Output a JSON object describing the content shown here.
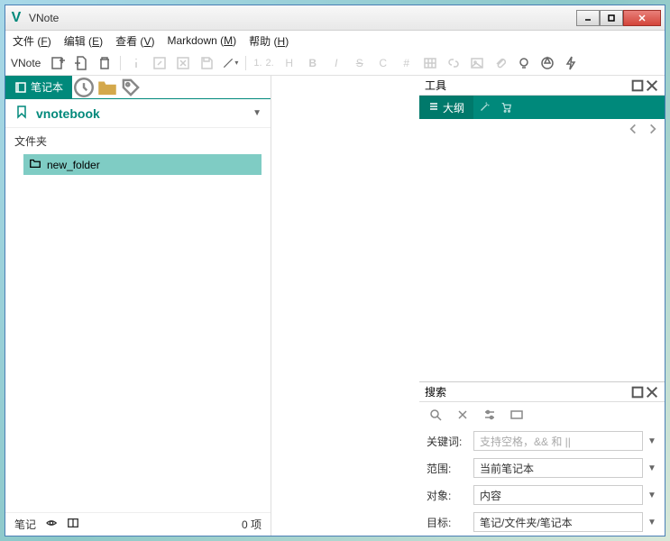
{
  "app": {
    "title": "VNote"
  },
  "menu": {
    "file": "文件",
    "file_k": "F",
    "edit": "编辑",
    "edit_k": "E",
    "view": "查看",
    "view_k": "V",
    "markdown": "Markdown",
    "markdown_k": "M",
    "help": "帮助",
    "help_k": "H"
  },
  "toolbar": {
    "label": "VNote",
    "numbers": [
      "1.",
      "2.",
      "H",
      "B",
      "I",
      "S",
      "C",
      "#"
    ]
  },
  "sidebar": {
    "tabs": {
      "notebook": "笔记本"
    },
    "notebook_name": "vnotebook",
    "folders_label": "文件夹",
    "folders": [
      {
        "name": "new_folder"
      }
    ],
    "notes_label": "笔记",
    "notes_count": "0 项"
  },
  "tools": {
    "title": "工具",
    "outline_tab": "大纲"
  },
  "search": {
    "title": "搜索",
    "keyword_label": "关键词:",
    "keyword_placeholder": "支持空格，&& 和 ||",
    "scope_label": "范围:",
    "scope_value": "当前笔记本",
    "object_label": "对象:",
    "object_value": "内容",
    "target_label": "目标:",
    "target_value": "笔记/文件夹/笔记本"
  }
}
